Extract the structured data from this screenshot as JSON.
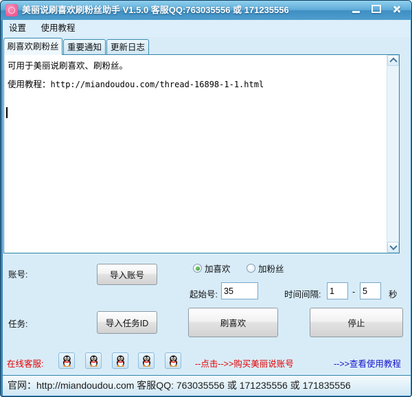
{
  "window": {
    "title": "美丽说刷喜欢刷粉丝助手 V1.5.0 客服QQ:763035556 或 171235556"
  },
  "menu": {
    "items": [
      "设置",
      "使用教程"
    ]
  },
  "tabs": [
    "刷喜欢刷粉丝",
    "重要通知",
    "更新日志"
  ],
  "content": {
    "line1": "可用于美丽说刷喜欢、刷粉丝。",
    "line2_label": "使用教程：",
    "line2_url": "http://miandoudou.com/thread-16898-1-1.html"
  },
  "form": {
    "account_label": "账号:",
    "import_account_button": "导入账号",
    "radio_like": "加喜欢",
    "radio_fans": "加粉丝",
    "radio_selected": "加喜欢",
    "start_label": "起始号:",
    "start_value": "35",
    "interval_label": "时间间隔:",
    "interval_min": "1",
    "interval_dash": "-",
    "interval_max": "5",
    "seconds_label": "秒",
    "task_label": "任务:",
    "import_task_button": "导入任务ID",
    "run_button": "刷喜欢",
    "stop_button": "停止"
  },
  "service": {
    "label": "在线客服:",
    "qq_icon": "qq-penguin",
    "qq_count": 5,
    "buy_link": "--点击-->>购买美丽说账号",
    "tutorial_link": "-->>查看使用教程"
  },
  "statusbar": {
    "text": "官网：http://miandoudou.com 客服QQ: 763035556 或 171235556 或 171835556"
  },
  "colors": {
    "titlebar_blue": "#4f9ccd",
    "client_background": "#d8ecf8",
    "brand_pink": "#ee5f96",
    "service_red": "#e40000",
    "link_blue": "#1414cc",
    "radio_green": "#2e8f2a",
    "textbox_border": "#77a7c8",
    "panel_border": "#2f85a8"
  }
}
